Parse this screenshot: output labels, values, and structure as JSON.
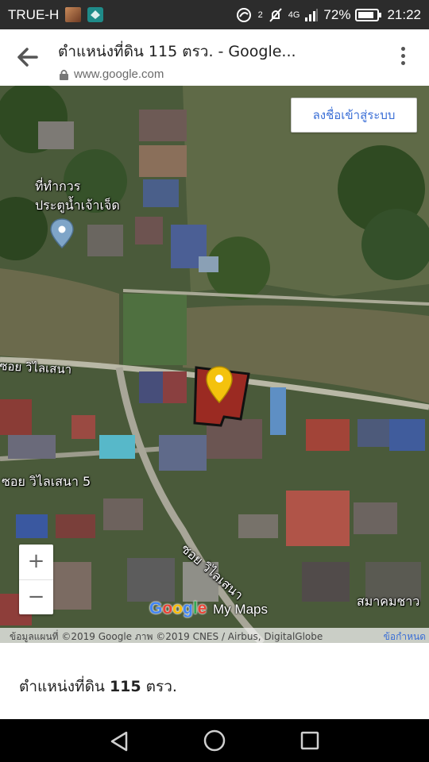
{
  "status_bar": {
    "carrier": "TRUE-H",
    "sim_slot": "2",
    "network": "4G",
    "battery": "72%",
    "time": "21:22"
  },
  "browser": {
    "title": "ตำแหน่งที่ดิน 115 ตรว. - Google...",
    "url": "www.google.com"
  },
  "map": {
    "signin_label": "ลงชื่อเข้าสู่ระบบ",
    "place_label_line1": "ที่ทำกวร",
    "place_label_line2": "ประตูน้ำเจ้าเจ็ด",
    "road_label_1": "ซอย วิไลเสนา",
    "road_label_2": "ซอย วิไลเสนา 5",
    "road_label_3": "ซอย วิไลเสนา",
    "poi_label": "สมาคมชาว",
    "zoom_in": "+",
    "zoom_out": "−",
    "logo_my": "My",
    "logo_maps": "Maps",
    "attribution": "ข้อมูลแผนที่ ©2019 Google ภาพ ©2019 CNES / Airbus, DigitalGlobe",
    "terms": "ข้อกำหนด",
    "colors": {
      "parcel": "#9b2a22",
      "marker": "#f4c20d",
      "river": "#6b6a4c"
    }
  },
  "footer": {
    "title_prefix": "ตำแหน่งที่ดิน ",
    "title_number": "115",
    "title_suffix": " ตรว."
  },
  "icons": {
    "back": "arrow-back-icon",
    "menu": "more-vert-icon",
    "lock": "lock-icon",
    "pin": "map-pin-icon",
    "nav_back": "triangle-back-icon",
    "nav_home": "circle-home-icon",
    "nav_recent": "square-recent-icon"
  }
}
